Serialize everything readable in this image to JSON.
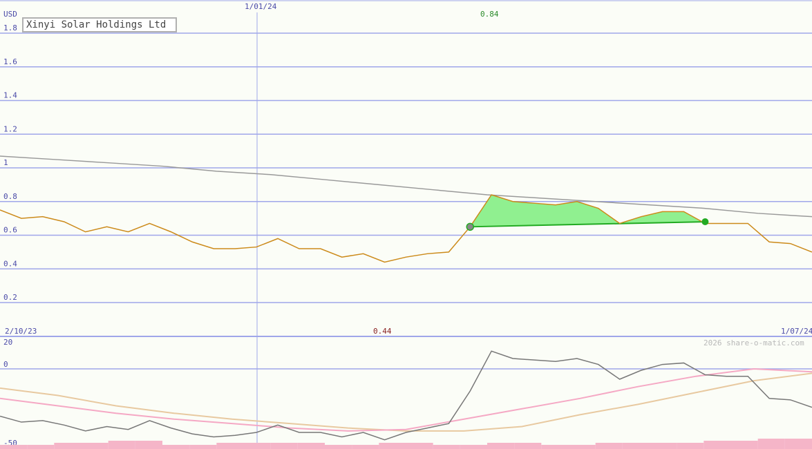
{
  "title": "Xinyi Solar Holdings Ltd",
  "copyright": "2026 share-o-matic.com",
  "colors": {
    "background": "#fbfdf7",
    "grid": "#9fa6ea",
    "axis_text": "#4a4aa8",
    "price": "#cc8a1a",
    "long_ma": "#999999",
    "highlight_fill": "#90f090",
    "highlight_line": "#22aa22",
    "high_label": "#2a8a2a",
    "low_label": "#8a2222",
    "osc_line": "#777777",
    "osc_pink": "#f5a8c4",
    "osc_tan": "#e8c9a0",
    "volume": "#f5b5c8"
  },
  "chart_data": [
    {
      "type": "line",
      "currency": "USD",
      "x_start_label": "2/10/23",
      "x_end_label": "1/07/24",
      "x_mid_label": "1/01/24",
      "ylim": [
        0.1,
        1.8
      ],
      "y_ticks": [
        "0.2",
        "0.4",
        "0.6",
        "0.8",
        "1",
        "1.2",
        "1.4",
        "1.6",
        "1.8"
      ],
      "max_label": "0.84",
      "min_label": "0.44",
      "grid": true,
      "series": [
        {
          "role": "price",
          "values": [
            0.75,
            0.7,
            0.71,
            0.68,
            0.62,
            0.65,
            0.62,
            0.67,
            0.62,
            0.56,
            0.52,
            0.52,
            0.53,
            0.58,
            0.52,
            0.52,
            0.47,
            0.49,
            0.44,
            0.47,
            0.49,
            0.5,
            0.65,
            0.84,
            0.8,
            0.79,
            0.78,
            0.8,
            0.76,
            0.67,
            0.71,
            0.74,
            0.74,
            0.67,
            0.67,
            0.67,
            0.56,
            0.55,
            0.5
          ]
        },
        {
          "role": "long-moving-average",
          "values": [
            1.07,
            1.05,
            1.03,
            1.01,
            0.98,
            0.96,
            0.93,
            0.9,
            0.87,
            0.84,
            0.82,
            0.8,
            0.78,
            0.76,
            0.73,
            0.71
          ]
        }
      ],
      "highlight": {
        "start_index": 22,
        "end_index": 33,
        "start_value": 0.65,
        "end_value": 0.68
      }
    },
    {
      "type": "line",
      "ylim": [
        -50,
        20
      ],
      "y_ticks": [
        "20",
        "0",
        "-50"
      ],
      "series": [
        {
          "role": "oscillator",
          "values": [
            -32,
            -36,
            -35,
            -38,
            -42,
            -39,
            -41,
            -35,
            -40,
            -44,
            -46,
            -45,
            -43,
            -38,
            -43,
            -43,
            -46,
            -43,
            -48,
            -43,
            -40,
            -37,
            -15,
            12,
            7,
            6,
            5,
            7,
            3,
            -7,
            -1,
            3,
            4,
            -4,
            -5,
            -5,
            -20,
            -21,
            -26
          ]
        },
        {
          "role": "signal-pink",
          "values": [
            -20,
            -25,
            -30,
            -34,
            -37,
            -40,
            -42,
            -41,
            -34,
            -27,
            -20,
            -12,
            -5,
            0,
            -2
          ]
        },
        {
          "role": "signal-tan",
          "values": [
            -13,
            -18,
            -25,
            -30,
            -34,
            -37,
            -40,
            -42,
            -42,
            -39,
            -31,
            -24,
            -16,
            -8,
            -3
          ]
        },
        {
          "role": "volume",
          "values": [
            2,
            2,
            3,
            3,
            4,
            4,
            2,
            2,
            3,
            3,
            3,
            3,
            2,
            2,
            3,
            3,
            2,
            2,
            3,
            3,
            2,
            2,
            3,
            3,
            3,
            3,
            4,
            4,
            5,
            5
          ]
        }
      ]
    }
  ]
}
